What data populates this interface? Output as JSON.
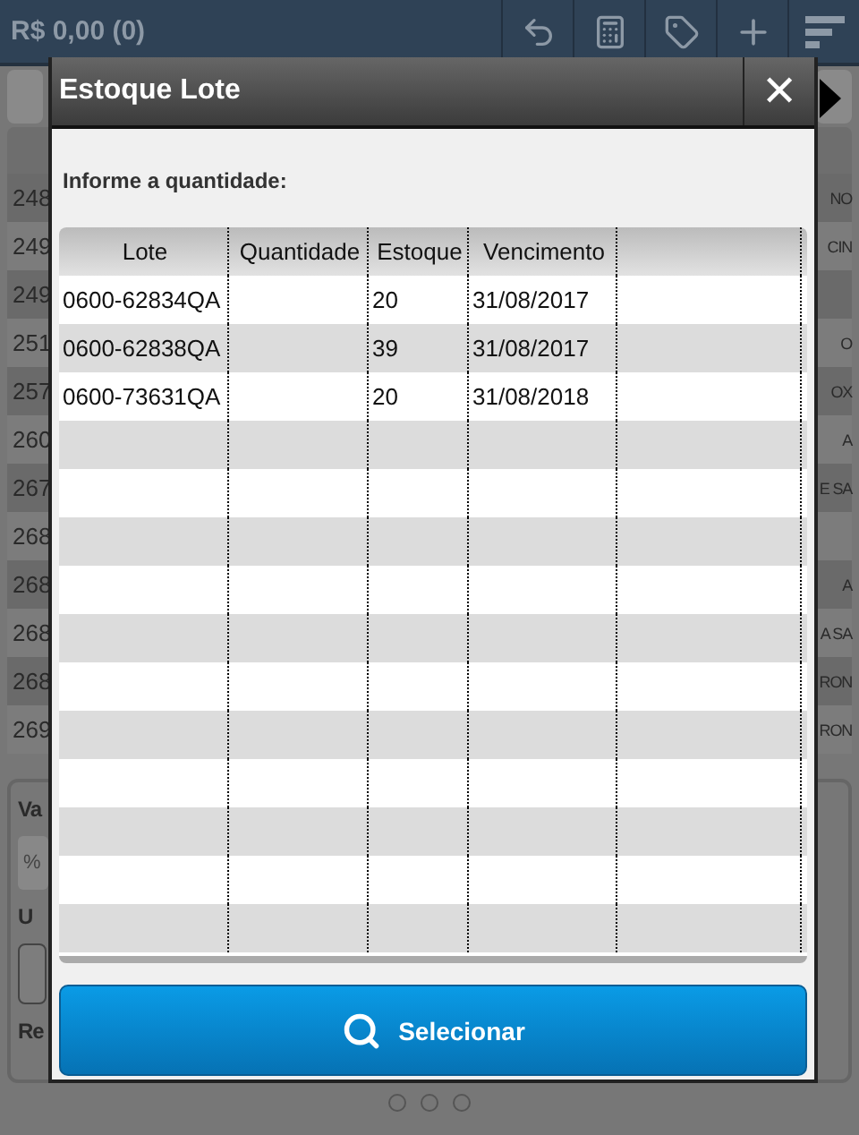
{
  "app_bar": {
    "total": "R$ 0,00 (0)"
  },
  "list": {
    "rows": [
      {
        "code": "248",
        "name": "NO"
      },
      {
        "code": "249",
        "name": "CIN"
      },
      {
        "code": "249"
      },
      {
        "code": "251",
        "name": "O"
      },
      {
        "code": "257",
        "name": "OX"
      },
      {
        "code": "260",
        "name": "A"
      },
      {
        "code": "267",
        "name": "E SA"
      },
      {
        "code": "268"
      },
      {
        "code": "268",
        "name": "A"
      },
      {
        "code": "268",
        "name": "A SA"
      },
      {
        "code": "268",
        "name": "RON"
      },
      {
        "code": "269",
        "name": "RON"
      }
    ]
  },
  "lower_panel": {
    "value_label": "Va",
    "percent_field": "%",
    "unit_label": "U",
    "remark_label": "Re"
  },
  "dialog": {
    "title": "Estoque Lote",
    "close": "✕",
    "prompt": "Informe a quantidade:",
    "columns": [
      "Lote",
      "Quantidade",
      "Estoque",
      "Vencimento"
    ],
    "rows": [
      {
        "lote": "0600-62834QA",
        "estoque": "20",
        "vencimento": "31/08/2017"
      },
      {
        "lote": "0600-62838QA",
        "estoque": "39",
        "vencimento": "31/08/2017"
      },
      {
        "lote": "0600-73631QA",
        "estoque": "20",
        "vencimento": "31/08/2018"
      }
    ],
    "button": "Selecionar"
  },
  "pager": [
    {
      "selected": false
    },
    {
      "selected": false
    },
    {
      "selected": false
    }
  ]
}
